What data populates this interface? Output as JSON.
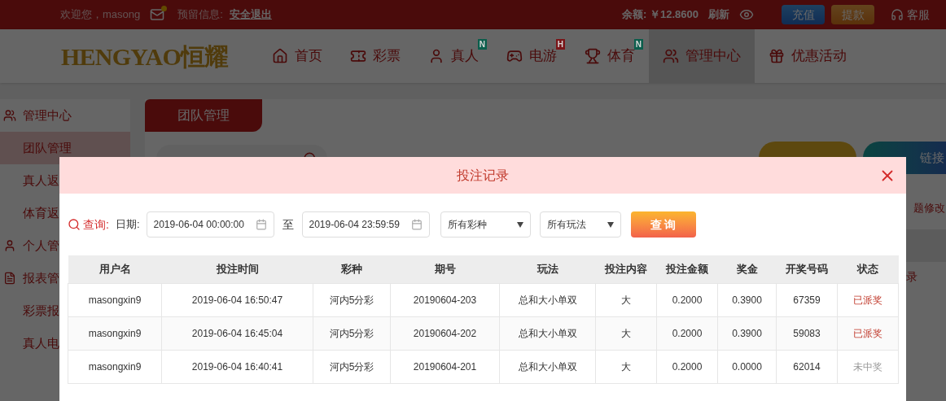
{
  "top_bar": {
    "welcome": "欢迎您，masong",
    "mail_unread": true,
    "reserved_info": "预留信息:",
    "logout": "安全退出",
    "balance": "余额: ￥12.8600",
    "refresh": "刷新",
    "deposit": "充值",
    "withdraw": "提款",
    "service": "客服"
  },
  "logo": "HENGYAO恒耀",
  "nav": [
    {
      "label": "首页",
      "selected": false
    },
    {
      "label": "彩票",
      "selected": false
    },
    {
      "label": "真人",
      "badge": {
        "text": "N",
        "color": "#0b5e4c"
      },
      "selected": false
    },
    {
      "label": "电游",
      "badge": {
        "text": "H",
        "color": "#7a1518"
      },
      "selected": false
    },
    {
      "label": "体育",
      "badge": {
        "text": "N",
        "color": "#0b5e4c"
      },
      "selected": false
    },
    {
      "label": "管理中心",
      "selected": true
    },
    {
      "label": "优惠活动",
      "selected": false
    }
  ],
  "sidebar": [
    {
      "kind": "header",
      "label": "管理中心",
      "selected": false
    },
    {
      "kind": "item",
      "label": "团队管理",
      "selected": true
    },
    {
      "kind": "item",
      "label": "真人返",
      "selected": false
    },
    {
      "kind": "item",
      "label": "体育返",
      "selected": false
    },
    {
      "kind": "header",
      "label": "个人管",
      "selected": false
    },
    {
      "kind": "header",
      "label": "报表管",
      "selected": false
    },
    {
      "kind": "item",
      "label": "彩票报",
      "selected": false
    },
    {
      "kind": "item",
      "label": "真人电",
      "selected": false
    }
  ],
  "content": {
    "tab": "团队管理",
    "side_texts": [
      "题修改",
      "录"
    ],
    "link_button": "链接"
  },
  "modal": {
    "title": "投注记录",
    "query_label": "查询:",
    "date_label": "日期:",
    "date_from": "2019-06-04 00:00:00",
    "to": "至",
    "date_to": "2019-06-04 23:59:59",
    "lottery_select": "所有彩种",
    "play_select": "所有玩法",
    "search_button": "查 询",
    "table": {
      "columns": [
        "用户名",
        "投注时间",
        "彩种",
        "期号",
        "玩法",
        "投注内容",
        "投注金额",
        "奖金",
        "开奖号码",
        "状态"
      ],
      "rows": [
        {
          "cells": [
            "masongxin9",
            "2019-06-04 16:50:47",
            "河内5分彩",
            "20190604-203",
            "总和大小单双",
            "大",
            "0.2000",
            "0.3900",
            "67359"
          ],
          "status": "已派奖",
          "kind": "paid"
        },
        {
          "cells": [
            "masongxin9",
            "2019-06-04 16:45:04",
            "河内5分彩",
            "20190604-202",
            "总和大小单双",
            "大",
            "0.2000",
            "0.3900",
            "59083"
          ],
          "status": "已派奖",
          "kind": "paid"
        },
        {
          "cells": [
            "masongxin9",
            "2019-06-04 16:40:41",
            "河内5分彩",
            "20190604-201",
            "总和大小单双",
            "大",
            "0.2000",
            "0.0000",
            "62014"
          ],
          "status": "未中奖",
          "kind": "lost"
        }
      ]
    }
  }
}
